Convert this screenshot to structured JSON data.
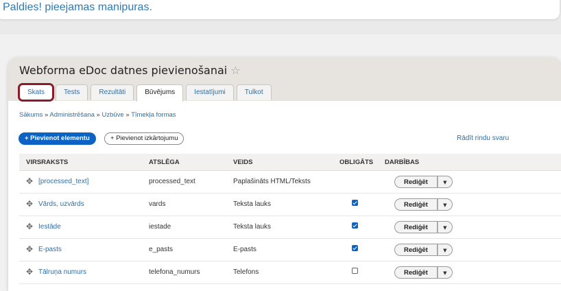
{
  "banner": {
    "text": "Paldies! pieejamas manipuras."
  },
  "page": {
    "title": "Webforma eDoc datnes pievienošanai"
  },
  "tabs": [
    {
      "label": "Skats",
      "state": "highlighted"
    },
    {
      "label": "Tests",
      "state": "normal"
    },
    {
      "label": "Rezultāti",
      "state": "normal"
    },
    {
      "label": "Būvējums",
      "state": "active"
    },
    {
      "label": "Iestatījumi",
      "state": "normal"
    },
    {
      "label": "Tulkot",
      "state": "normal"
    }
  ],
  "breadcrumb": {
    "items": [
      "Sākums",
      "Administrēšana",
      "Uzbūve",
      "Tīmekļa formas"
    ],
    "separator": "»"
  },
  "actions": {
    "add_element": "+ Pievienot elementu",
    "add_layout": "+ Pievienot izkārtojumu",
    "show_row_weights": "Rādīt rindu svaru"
  },
  "table": {
    "headers": {
      "title": "VIRSRAKSTS",
      "key": "ATSLĒGA",
      "type": "VEIDS",
      "required": "OBLIGĀTS",
      "operations": "DARBĪBAS"
    },
    "rows": [
      {
        "title": "[processed_text]",
        "key": "processed_text",
        "type": "Paplašināts HTML/Teksts",
        "required": null,
        "edit": "Rediģēt"
      },
      {
        "title": "Vārds, uzvārds",
        "key": "vards",
        "type": "Teksta lauks",
        "required": true,
        "edit": "Rediģēt"
      },
      {
        "title": "Iestāde",
        "key": "iestade",
        "type": "Teksta lauks",
        "required": true,
        "edit": "Rediģēt"
      },
      {
        "title": "E-pasts",
        "key": "e_pasts",
        "type": "E-pasts",
        "required": true,
        "edit": "Rediģēt"
      },
      {
        "title": "Tālruņa numurs",
        "key": "telefona_numurs",
        "type": "Telefons",
        "required": false,
        "edit": "Rediģēt"
      }
    ]
  },
  "colors": {
    "link": "#2e6ea6",
    "primary": "#0d63c4",
    "highlight_outline": "#8a1c2a",
    "title_bar": "#e7e4df"
  },
  "icons": {
    "star": "star-outline-icon",
    "drag": "drag-handle-icon",
    "dropdown": "chevron-down-icon"
  }
}
